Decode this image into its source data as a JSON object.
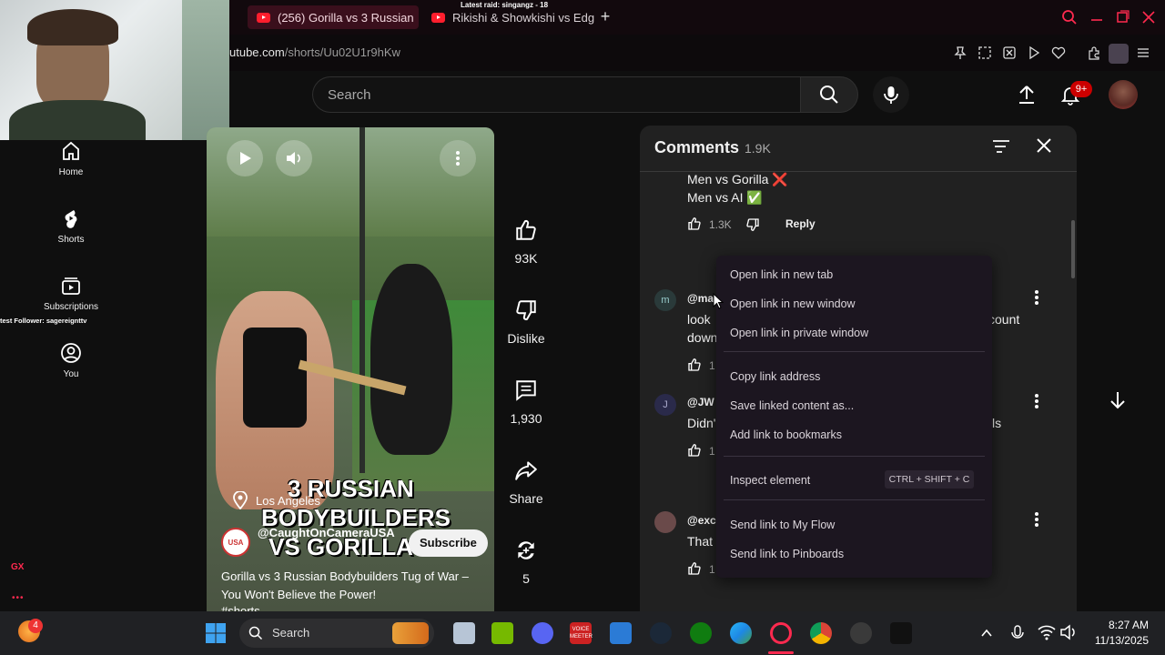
{
  "browser": {
    "tabs": [
      {
        "title": "(256) Gorilla vs 3 Russian",
        "active": true
      },
      {
        "title": "Rikishi & Showkishi vs Edg",
        "active": false
      }
    ],
    "new_tab": "+",
    "url_host": "utube.com",
    "url_path": "/shorts/Uu02U1r9hKw",
    "stream_overlay": "Latest raid: singangz - 18",
    "follower_overlay": "test Follower: sagereignttv"
  },
  "youtube": {
    "search_placeholder": "Search",
    "notifications_badge": "9+",
    "nav": [
      {
        "label": "Home",
        "icon": "home-icon"
      },
      {
        "label": "Shorts",
        "icon": "shorts-icon"
      },
      {
        "label": "Subscriptions",
        "icon": "subscriptions-icon"
      },
      {
        "label": "You",
        "icon": "you-icon"
      }
    ]
  },
  "short": {
    "overlay_title_1": "3 RUSSIAN",
    "overlay_title_2": "BODYBUILDERS",
    "overlay_title_3": "VS GORILLA",
    "location": "Los Angeles",
    "channel": "@CaughtOnCameraUSA",
    "subscribe": "Subscribe",
    "title": "Gorilla vs 3 Russian Bodybuilders Tug of War – You Won't Believe the Power!",
    "hashtag": "#shorts",
    "likes": "93K",
    "dislike": "Dislike",
    "comments_count": "1,930",
    "share": "Share",
    "remix_count": "5"
  },
  "comments_panel": {
    "title": "Comments",
    "count": "1.9K",
    "first": {
      "line1": "Men vs Gorilla ❌",
      "line2": "Men vs AI ✅",
      "likes": "1.3K",
      "reply": "Reply"
    },
    "items": [
      {
        "avatar": "m",
        "handle": "@ma",
        "text1": "look",
        "text2": "down",
        "text_right": "count",
        "likes": "1"
      },
      {
        "avatar": "J",
        "handle": "@JW",
        "text1": "Didn'",
        "text_right": "ls",
        "likes": "1"
      },
      {
        "avatar": "",
        "handle": "@exc",
        "text1": "That",
        "likes": "1"
      }
    ]
  },
  "context_menu": {
    "open_new_tab": "Open link in new tab",
    "open_new_window": "Open link in new window",
    "open_private": "Open link in private window",
    "copy_link": "Copy link address",
    "save_linked": "Save linked content as...",
    "add_bookmarks": "Add link to bookmarks",
    "inspect": "Inspect element",
    "inspect_shortcut": "CTRL + SHIFT + C",
    "send_flow": "Send link to My Flow",
    "send_pinboards": "Send link to Pinboards"
  },
  "taskbar": {
    "search": "Search",
    "time": "8:27 AM",
    "date": "11/13/2025",
    "notif_badge": "4",
    "voicemeeter": "VOICE MEETER",
    "gx": "GX"
  },
  "colors": {
    "opera_red": "#ff2a4f",
    "youtube_red": "#ff0000",
    "menu_bg": "#1c1620",
    "panel_bg": "#212121"
  }
}
